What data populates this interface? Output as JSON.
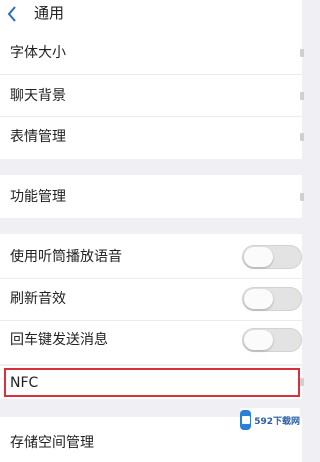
{
  "header": {
    "title": "通用"
  },
  "items": {
    "font_size": "字体大小",
    "chat_background": "聊天背景",
    "emoji_manage": "表情管理",
    "feature_manage": "功能管理",
    "earpiece_play": "使用听筒播放语音",
    "refresh_sound": "刷新音效",
    "enter_send": "回车键发送消息",
    "nfc": "NFC",
    "storage_manage": "存储空间管理"
  },
  "toggles": {
    "earpiece_play": false,
    "refresh_sound": false,
    "enter_send": false
  },
  "colors": {
    "highlight": "#d9303a",
    "back_arrow": "#2e6bbf",
    "background": "#efeff4"
  },
  "watermark": {
    "text": "592下载网"
  }
}
